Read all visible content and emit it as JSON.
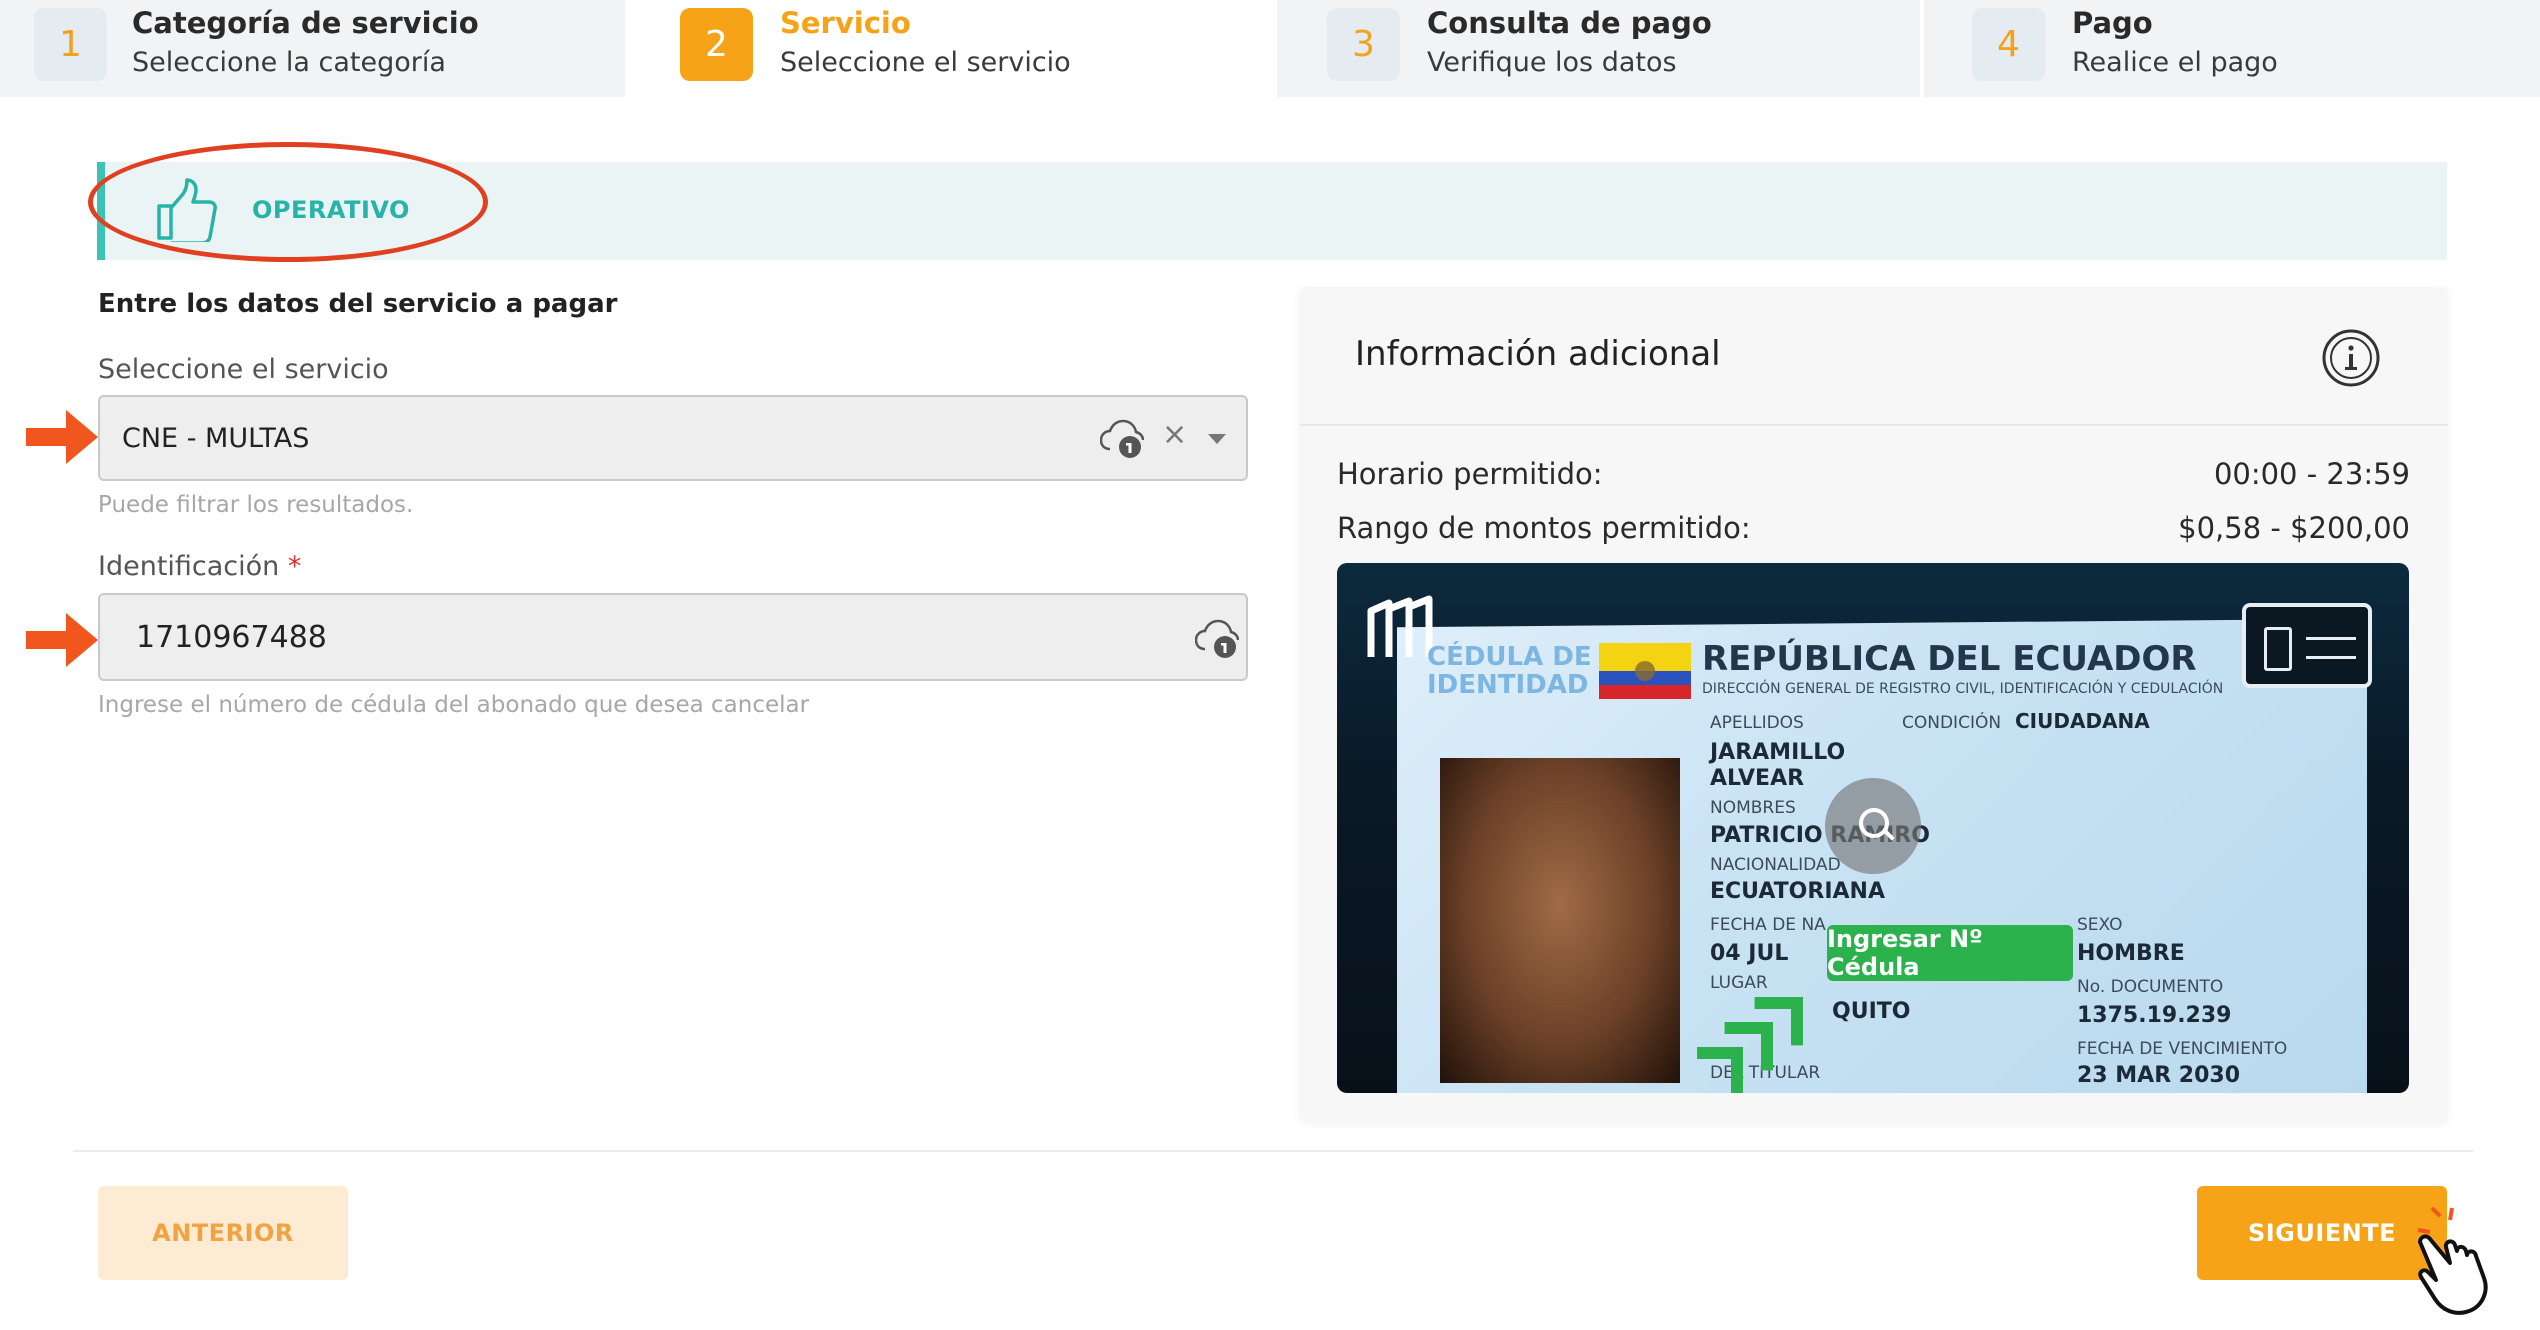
{
  "stepper": [
    {
      "number": "1",
      "title": "Categoría de servicio",
      "subtitle": "Seleccione la categoría"
    },
    {
      "number": "2",
      "title": "Servicio",
      "subtitle": "Seleccione el servicio"
    },
    {
      "number": "3",
      "title": "Consulta de pago",
      "subtitle": "Verifique los datos"
    },
    {
      "number": "4",
      "title": "Pago",
      "subtitle": "Realice el pago"
    }
  ],
  "status": {
    "label": "OPERATIVO",
    "icon": "thumbs-up-icon",
    "accent": "#3cc3b7",
    "highlight_color": "#e0401f"
  },
  "form": {
    "heading": "Entre los datos del servicio a pagar",
    "service": {
      "label": "Seleccione el servicio",
      "value": "CNE - MULTAS",
      "clear": "×",
      "help": "Puede filtrar los resultados."
    },
    "identification": {
      "label": "Identificación",
      "required_mark": "*",
      "value": "1710967488",
      "help": "Ingrese el número de cédula del abonado que desea cancelar"
    }
  },
  "info": {
    "title": "Información adicional",
    "rows": [
      {
        "key": "Horario permitido:",
        "value": "00:00 - 23:59"
      },
      {
        "key": "Rango de montos permitido:",
        "value": "$0,58 - $200,00"
      }
    ],
    "id_card": {
      "cedula": "CÉDULA DE IDENTIDAD",
      "republic": "REPÚBLICA DEL ECUADOR",
      "directorate": "DIRECCIÓN GENERAL DE REGISTRO CIVIL, IDENTIFICACIÓN Y CEDULACIÓN",
      "apellidos_label": "APELLIDOS",
      "apellidos_1": "JARAMILLO",
      "apellidos_2": "ALVEAR",
      "condicion_label": "CONDICIÓN",
      "condicion": "CIUDADANA",
      "nombres_label": "NOMBRES",
      "nombres": "PATRICIO RAMIRO",
      "nacionalidad_label": "NACIONALIDAD",
      "nacionalidad": "ECUATORIANA",
      "fecha_nac_label": "FECHA DE NA",
      "fecha_nac": "04 JUL",
      "lugar_label": "LUGAR",
      "lugar": "QUITO",
      "sexo_label": "SEXO",
      "sexo": "HOMBRE",
      "documento_label": "No. DOCUMENTO",
      "documento": "1375.19.239",
      "vencimiento_label": "FECHA DE VENCIMIENTO",
      "vencimiento": "23 MAR 2030",
      "badge": "Ingresar Nº Cédula",
      "titular": "DEL TITULAR"
    }
  },
  "footer": {
    "prev_label": "ANTERIOR",
    "next_label": "SIGUIENTE"
  },
  "colors": {
    "primary": "#f7a317",
    "arrow": "#f0561d",
    "success": "#2bb24c"
  }
}
